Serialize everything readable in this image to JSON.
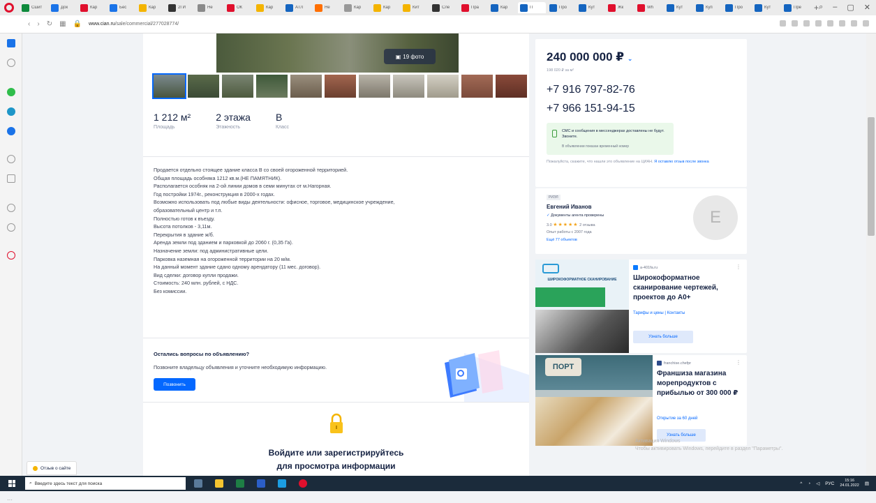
{
  "browser": {
    "tabs": [
      {
        "label": "Сшит",
        "color": "#0e8a3c"
      },
      {
        "label": "Док",
        "color": "#1a73e8"
      },
      {
        "label": "Кар",
        "color": "#e0102d"
      },
      {
        "label": "Бес",
        "color": "#1a73e8"
      },
      {
        "label": "Кар",
        "color": "#f4b400"
      },
      {
        "label": "2ГИ",
        "color": "#333333"
      },
      {
        "label": "Не",
        "color": "#8a8a8a"
      },
      {
        "label": "ОК",
        "color": "#e0102d"
      },
      {
        "label": "Кар",
        "color": "#f4b400"
      },
      {
        "label": "АТЛ",
        "color": "#1565c0"
      },
      {
        "label": "Не",
        "color": "#ff6f00"
      },
      {
        "label": "Кар",
        "color": "#999999"
      },
      {
        "label": "Кар",
        "color": "#f4b400"
      },
      {
        "label": "Кит",
        "color": "#f4b400"
      },
      {
        "label": "Сле",
        "color": "#333333"
      },
      {
        "label": "Пра",
        "color": "#e0102d"
      },
      {
        "label": "Кар",
        "color": "#1565c0"
      },
      {
        "label": "П",
        "color": "#1565c0",
        "active": true
      },
      {
        "label": "Про",
        "color": "#1565c0"
      },
      {
        "label": "Кут",
        "color": "#1565c0"
      },
      {
        "label": "Жк",
        "color": "#e0102d"
      },
      {
        "label": "Wh",
        "color": "#e0102d"
      },
      {
        "label": "Кут",
        "color": "#1565c0"
      },
      {
        "label": "Куп",
        "color": "#1565c0"
      },
      {
        "label": "Про",
        "color": "#1565c0"
      },
      {
        "label": "Кут",
        "color": "#1565c0"
      },
      {
        "label": "Пре",
        "color": "#1565c0"
      }
    ],
    "url_domain": "www.cian.ru",
    "url_path": "/sale/commercial/277028774/"
  },
  "listing": {
    "photo_count": "19 фото",
    "specs": [
      {
        "value": "1 212 м²",
        "label": "Площадь"
      },
      {
        "value": "2 этажа",
        "label": "Этажность"
      },
      {
        "value": "B",
        "label": "Класс"
      }
    ],
    "description": [
      "Продается отдельно стоящее здание класса B со своей огороженной территорией.",
      "Общая площадь особняка 1212 кв.м.(НЕ ПАМЯТНИК).",
      "Располагается особняк на 2-ой линии домов в семи минутах от м.Нагорная.",
      "Год постройки 1974г., реконструкция в 2000-х годах.",
      "Возможно использовать под любые виды деятельности: офисное, торговое, медицинское учреждение,",
      "образовательный центр и т.п.",
      "Полностью готов к въезду.",
      "Высота потолков - 3,11м.",
      "Перекрытия в здание ж/б.",
      "Аренда земли под зданием и парковкой до 2060 г. (0,35 Га).",
      "Назначение земли: под административные цели.",
      "Парковка наземная на огороженной территории на 20 м/м.",
      "На данный момент здание сдано одному арендатору (11 мес. договор).",
      "Вид сделки: договор купли продажи.",
      "Стоимость: 240 млн. рублей, с НДС.",
      "Без комиссии."
    ],
    "question_title": "Остались вопросы по объявлению?",
    "question_text": "Позвоните владельцу объявления и уточните необходимую информацию.",
    "call_button": "Позвонить",
    "login_text_1": "Войдите или зарегистрируйтесь",
    "login_text_2": "для просмотра информации"
  },
  "sidebar_price": {
    "price": "240 000 000 ₽",
    "price_per_m": "198 020 ₽ за м²",
    "phones": [
      "+7 916 797-82-76",
      "+7 966 151-94-15"
    ],
    "sms_title": "СМС и сообщения в мессенджерах доставлены не будут. Звоните.",
    "sms_sub": "В объявлении показан временный номер",
    "warning": "Пожалуйста, скажите, что нашли это объявление на ЦИАН.",
    "warning_link": "Я оставлю отзыв после звонка"
  },
  "agent": {
    "tag": "РИЭЛ",
    "name": "Евгений Иванов",
    "verified": "Документы агента проверены",
    "rating": "3.0",
    "stars": "★★★★★",
    "reviews": "2 отзыва",
    "experience": "Опыт работы с 2007 года",
    "objects": "Ещё 77 объектов",
    "avatar_letter": "E"
  },
  "ads": [
    {
      "source": "a-401fa.ru",
      "title": "Широкоформатное сканирование чертежей, проектов до А0+",
      "links": "Тарифы и цены  |  Контакты",
      "button": "Узнать больше",
      "image_title": "ШИРОКОФОРМАТНОЕ СКАНИРОВАНИЕ"
    },
    {
      "source": "franchise.chefpr",
      "title": "Франшиза магазина морепродуктов с прибылью от 300 000 ₽",
      "links": "Открытие за 60 дней",
      "button": "Узнать больше",
      "image_title": "ПОРТ"
    }
  ],
  "windows_activation": {
    "line1": "Активация Windows",
    "line2": "Чтобы активировать Windows, перейдите в раздел \"Параметры\"."
  },
  "feedback_button": "Отзыв о сайте",
  "taskbar": {
    "search_placeholder": "Введите здесь текст для поиска",
    "lang": "РУС",
    "time": "15:16",
    "date": "24.01.2022"
  }
}
